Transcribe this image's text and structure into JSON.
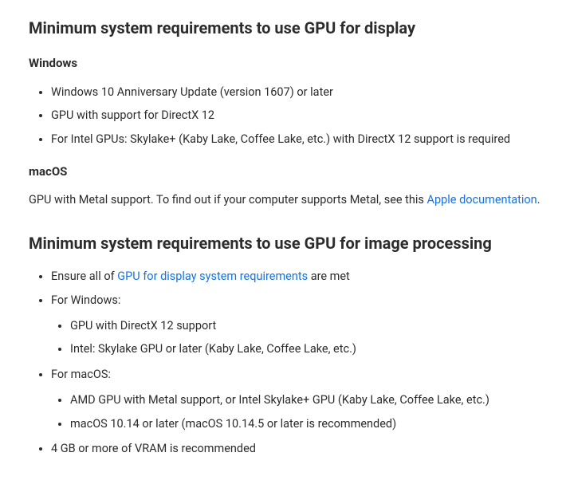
{
  "section1": {
    "heading": "Minimum system requirements to use GPU for display",
    "windows": {
      "label": "Windows",
      "items": [
        "Windows 10 Anniversary Update (version 1607) or later",
        "GPU with support for DirectX 12",
        "For Intel GPUs: Skylake+ (Kaby Lake, Coffee Lake, etc.) with DirectX 12 support is required"
      ]
    },
    "macos": {
      "label": "macOS",
      "text_before_link": "GPU with Metal support. To find out if your computer supports Metal, see this ",
      "link_text": "Apple documentation",
      "text_after_link": "."
    }
  },
  "section2": {
    "heading": "Minimum system requirements to use GPU for image processing",
    "item1_before_link": "Ensure all of ",
    "item1_link": "GPU for display system requirements",
    "item1_after_link": " are met",
    "item2_label": "For Windows:",
    "item2_subitems": [
      "GPU with DirectX 12 support",
      "Intel: Skylake GPU or later (Kaby Lake, Coffee Lake, etc.)"
    ],
    "item3_label": "For macOS:",
    "item3_subitems": [
      "AMD GPU with Metal support, or Intel Skylake+ GPU (Kaby Lake, Coffee Lake, etc.)",
      "macOS 10.14 or later (macOS 10.14.5 or later is recommended)"
    ],
    "item4": "4 GB or more of VRAM is recommended"
  }
}
